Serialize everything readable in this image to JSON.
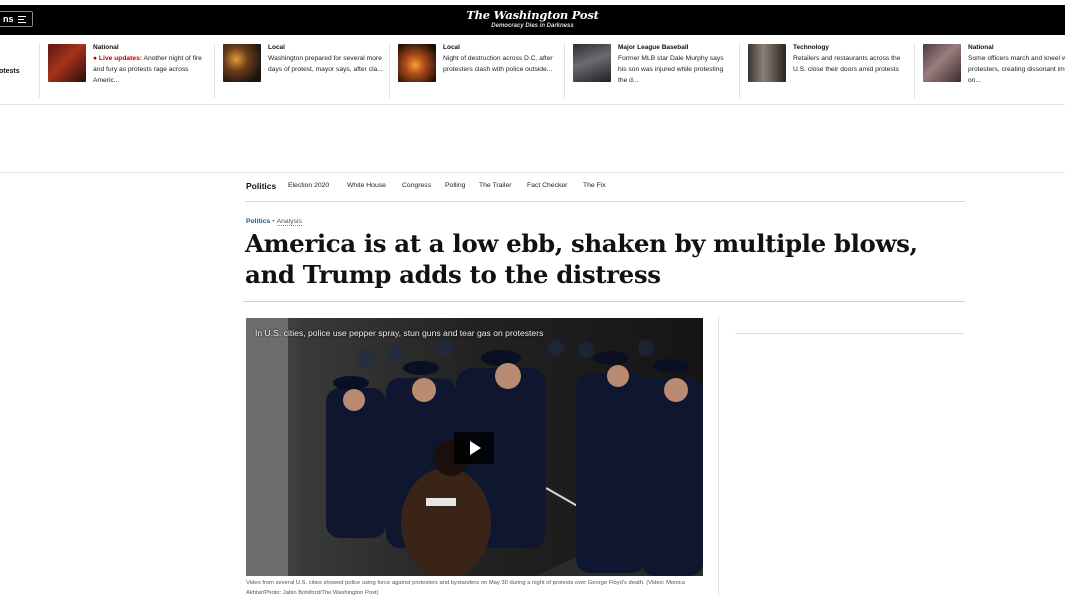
{
  "topbar": {
    "sections_label": "ns",
    "logo": "The Washington Post",
    "tagline": "Democracy Dies in Darkness"
  },
  "rail": {
    "clipped_text": "otests",
    "items": [
      {
        "kicker": "National",
        "live": "Live updates:",
        "headline": "Another night of fire and fury as protests rage across Americ..."
      },
      {
        "kicker": "Local",
        "headline": "Washington prepared for several more days of protest, mayor says, after cla..."
      },
      {
        "kicker": "Local",
        "headline": "Night of destruction across D.C. after protesters clash with police outside..."
      },
      {
        "kicker": "Major League Baseball",
        "headline": "Former MLB star Dale Murphy says his son was injured while protesting the d..."
      },
      {
        "kicker": "Technology",
        "headline": "Retailers and restaurants across the U.S. close their doors amid protests"
      },
      {
        "kicker": "National",
        "headline": "Some officers march and kneel with protesters, creating dissonant images on..."
      }
    ]
  },
  "subnav": {
    "home": "Politics",
    "links": [
      "Election 2020",
      "White House",
      "Congress",
      "Polling",
      "The Trailer",
      "Fact Checker",
      "The Fix"
    ]
  },
  "article": {
    "section": "Politics",
    "label": "Analysis",
    "headline": "America is at a low ebb, shaken by multiple blows, and Trump adds to the distress"
  },
  "video": {
    "title": "In U.S. cities, police use pepper spray, stun guns and tear gas on protesters",
    "caption": "Video from several U.S. cities showed police using force against protesters and bystanders on May 30 during a night of protests over George Floyd's death. (Video: Monica Akhtar/Photo: Jabin Botsford/The Washington Post)"
  },
  "colors": {
    "topbar": "#000000",
    "live": "#c20000",
    "section_link": "#1955a5"
  }
}
